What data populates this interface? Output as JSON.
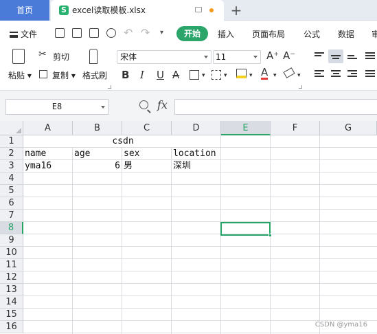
{
  "tabs": {
    "home": "首页",
    "file_name": "excel读取模板.xlsx",
    "add": "+"
  },
  "menu": {
    "file": "文件",
    "items": [
      "开始",
      "插入",
      "页面布局",
      "公式",
      "数据",
      "审"
    ]
  },
  "ribbon": {
    "paste": "粘贴",
    "cut": "剪切",
    "copy": "复制",
    "format_painter": "格式刷",
    "font_name": "宋体",
    "font_size": "11",
    "grow_font": "A⁺",
    "shrink_font": "A⁻",
    "bold": "B",
    "italic": "I",
    "underline": "U",
    "strike": "A"
  },
  "formula_bar": {
    "name_box": "E8",
    "fx": "fx",
    "formula": ""
  },
  "sheet": {
    "columns": [
      "A",
      "B",
      "C",
      "D",
      "E",
      "F",
      "G"
    ],
    "selected_column": "E",
    "rows": [
      "1",
      "2",
      "3",
      "4",
      "5",
      "6",
      "7",
      "8",
      "9",
      "10",
      "11",
      "12",
      "13",
      "14",
      "15",
      "16"
    ],
    "selected_row": "8",
    "cells": {
      "title": "csdn",
      "A2": "name",
      "B2": "age",
      "C2": "sex",
      "D2": "location",
      "A3": "yma16",
      "B3": "6",
      "C3": "男",
      "D3": "深圳"
    }
  },
  "watermark": "CSDN @yma16",
  "colors": {
    "accent_green": "#27a567",
    "home_tab": "#4b7bd9",
    "modified_dot": "#f39a1e"
  }
}
